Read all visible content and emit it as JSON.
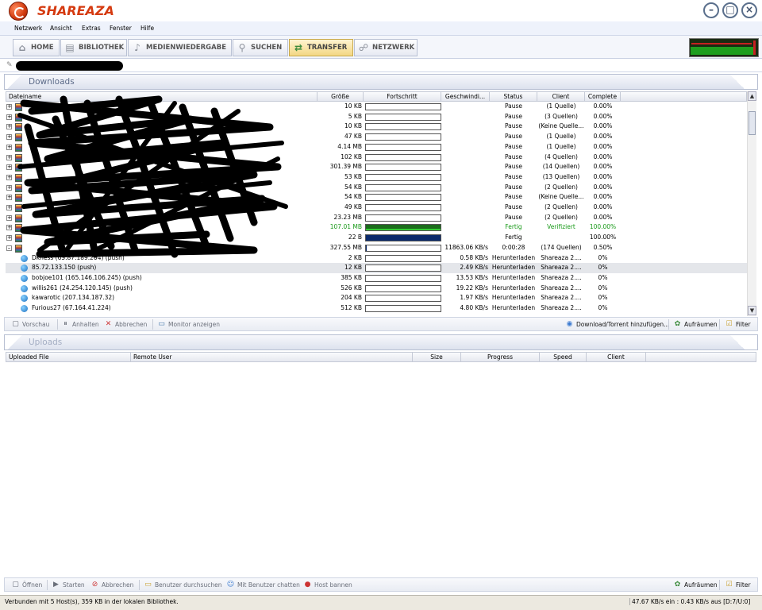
{
  "app": {
    "title": "SHAREAZA"
  },
  "menu": [
    "Netzwerk",
    "Ansicht",
    "Extras",
    "Fenster",
    "Hilfe"
  ],
  "nav": [
    {
      "label": "HOME",
      "icon": "home-icon",
      "active": false
    },
    {
      "label": "BIBLIOTHEK",
      "icon": "library-icon",
      "active": false
    },
    {
      "label": "MEDIENWIEDERGABE",
      "icon": "media-icon",
      "active": false
    },
    {
      "label": "SUCHEN",
      "icon": "search-icon",
      "active": false
    },
    {
      "label": "TRANSFER",
      "icon": "transfer-icon",
      "active": true
    },
    {
      "label": "NETZWERK",
      "icon": "network-icon",
      "active": false
    }
  ],
  "downloads": {
    "title": "Downloads",
    "columns": [
      "Dateiname",
      "Größe",
      "Fortschritt",
      "Geschwindi...",
      "Status",
      "Client",
      "Complete"
    ],
    "rows": [
      {
        "kind": "file",
        "name": "",
        "size": "10 KB",
        "progress": 0,
        "speed": "",
        "status": "Pause",
        "client": "(1 Quelle)",
        "complete": "0.00%"
      },
      {
        "kind": "file",
        "name": "",
        "size": "5 KB",
        "progress": 0,
        "speed": "",
        "status": "Pause",
        "client": "(3 Quellen)",
        "complete": "0.00%"
      },
      {
        "kind": "file",
        "name": "",
        "size": "10 KB",
        "progress": 0,
        "speed": "",
        "status": "Pause",
        "client": "(Keine Quelle...",
        "complete": "0.00%"
      },
      {
        "kind": "file",
        "name": "",
        "size": "47 KB",
        "progress": 0,
        "speed": "",
        "status": "Pause",
        "client": "(1 Quelle)",
        "complete": "0.00%"
      },
      {
        "kind": "file",
        "name": "",
        "size": "4.14 MB",
        "progress": 0,
        "speed": "",
        "status": "Pause",
        "client": "(1 Quelle)",
        "complete": "0.00%"
      },
      {
        "kind": "file",
        "name": "",
        "size": "102 KB",
        "progress": 0,
        "speed": "",
        "status": "Pause",
        "client": "(4 Quellen)",
        "complete": "0.00%"
      },
      {
        "kind": "file",
        "name": "",
        "size": "301.39 MB",
        "progress": 0,
        "speed": "",
        "status": "Pause",
        "client": "(14 Quellen)",
        "complete": "0.00%"
      },
      {
        "kind": "file",
        "name": "",
        "size": "53 KB",
        "progress": 0,
        "speed": "",
        "status": "Pause",
        "client": "(13 Quellen)",
        "complete": "0.00%"
      },
      {
        "kind": "file",
        "name": "",
        "size": "54 KB",
        "progress": 0,
        "speed": "",
        "status": "Pause",
        "client": "(2 Quellen)",
        "complete": "0.00%"
      },
      {
        "kind": "file",
        "name": "",
        "size": "54 KB",
        "progress": 0,
        "speed": "",
        "status": "Pause",
        "client": "(Keine Quelle...",
        "complete": "0.00%"
      },
      {
        "kind": "file",
        "name": "",
        "size": "49 KB",
        "progress": 0,
        "speed": "",
        "status": "Pause",
        "client": "(2 Quellen)",
        "complete": "0.00%"
      },
      {
        "kind": "file",
        "name": "",
        "size": "23.23 MB",
        "progress": 0,
        "speed": "",
        "status": "Pause",
        "client": "(2 Quellen)",
        "complete": "0.00%"
      },
      {
        "kind": "file",
        "name": "",
        "size": "107.01 MB",
        "progress": 1,
        "speed": "",
        "status": "Fertig",
        "client": "Verifiziert",
        "complete": "100.00%",
        "color": "green",
        "fill": "#1a6b1a"
      },
      {
        "kind": "file",
        "name": "",
        "size": "22 B",
        "progress": 1,
        "speed": "",
        "status": "Fertig",
        "client": "",
        "complete": "100.00%",
        "fill": "#0b2a6b"
      },
      {
        "kind": "file",
        "name": "",
        "size": "327.55 MB",
        "progress": 0.005,
        "speed": "11863.06 KB/s",
        "status": "0:00:28",
        "client": "(174 Quellen)",
        "complete": "0.50%",
        "fill": "#0b2a6b"
      },
      {
        "kind": "source",
        "name": "Dkness (65.87.189.204) (push)",
        "size": "2 KB",
        "progress": 0,
        "speed": "0.58 KB/s",
        "status": "Herunterladen",
        "client": "Shareaza 2....",
        "complete": "0%"
      },
      {
        "kind": "source",
        "name": "85.72.133.150 (push)",
        "size": "12 KB",
        "progress": 0,
        "speed": "2.49 KB/s",
        "status": "Herunterladen",
        "client": "Shareaza 2....",
        "complete": "0%",
        "selected": true
      },
      {
        "kind": "source",
        "name": "bobjoe101 (165.146.106.245) (push)",
        "size": "385 KB",
        "progress": 0,
        "speed": "13.53 KB/s",
        "status": "Herunterladen",
        "client": "Shareaza 2....",
        "complete": "0%"
      },
      {
        "kind": "source",
        "name": "willis261 (24.254.120.145) (push)",
        "size": "526 KB",
        "progress": 0,
        "speed": "19.22 KB/s",
        "status": "Herunterladen",
        "client": "Shareaza 2....",
        "complete": "0%"
      },
      {
        "kind": "source",
        "name": "kawarotic (207.134.187.32)",
        "size": "204 KB",
        "progress": 0,
        "speed": "1.97 KB/s",
        "status": "Herunterladen",
        "client": "Shareaza 2....",
        "complete": "0%"
      },
      {
        "kind": "source",
        "name": "Furious27 (67.164.41.224)",
        "size": "512 KB",
        "progress": 0,
        "speed": "4.80 KB/s",
        "status": "Herunterladen",
        "client": "Shareaza 2....",
        "complete": "0%"
      }
    ],
    "toolbar": {
      "preview": "Vorschau",
      "pause": "Anhalten",
      "cancel": "Abbrechen",
      "monitor": "Monitor anzeigen",
      "add": "Download/Torrent hinzufügen...",
      "clear": "Aufräumen",
      "filter": "Filter"
    }
  },
  "uploads": {
    "title": "Uploads",
    "columns": [
      "Uploaded File",
      "Remote User",
      "Size",
      "Progress",
      "Speed",
      "Client"
    ],
    "toolbar": {
      "open": "Öffnen",
      "start": "Starten",
      "cancel": "Abbrechen",
      "browse": "Benutzer durchsuchen",
      "chat": "Mit Benutzer chatten",
      "ban": "Host bannen",
      "clear": "Aufräumen",
      "filter": "Filter"
    }
  },
  "status": {
    "left": "Verbunden mit 5 Host(s), 359 KB in der lokalen Bibliothek.",
    "right": "47.67 KB/s ein : 0.43 KB/s aus [D:7/U:0]"
  }
}
